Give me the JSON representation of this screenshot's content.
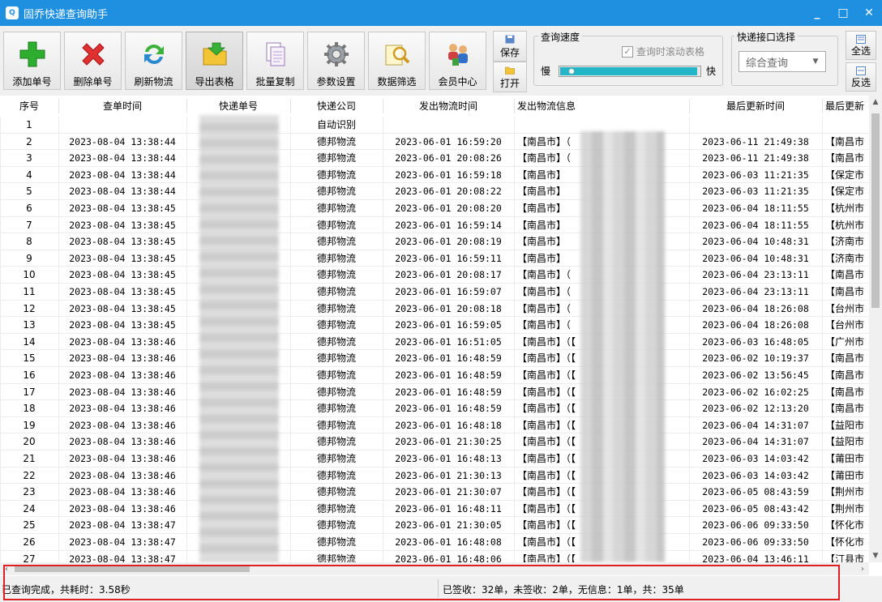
{
  "window": {
    "title": "固乔快递查询助手",
    "minimize": "_",
    "maximize": "□",
    "close": "✕"
  },
  "toolbar": {
    "buttons": [
      {
        "label": "添加单号",
        "icon": "plus-icon"
      },
      {
        "label": "删除单号",
        "icon": "delete-x-icon"
      },
      {
        "label": "刷新物流",
        "icon": "refresh-icon"
      },
      {
        "label": "导出表格",
        "icon": "folder-export-icon"
      },
      {
        "label": "批量复制",
        "icon": "copy-icon"
      },
      {
        "label": "参数设置",
        "icon": "gear-icon"
      },
      {
        "label": "数据筛选",
        "icon": "filter-search-icon"
      },
      {
        "label": "会员中心",
        "icon": "members-icon"
      }
    ],
    "save_label": "保存",
    "open_label": "打开",
    "speed_group": {
      "title": "查询速度",
      "scroll_checkbox_label": "查询时滚动表格",
      "scroll_checked": true,
      "slow_label": "慢",
      "fast_label": "快",
      "speed_level": 0.98
    },
    "api_group": {
      "title": "快递接口选择",
      "selected": "综合查询"
    },
    "select_all_label": "全选",
    "invert_label": "反选"
  },
  "table": {
    "columns": [
      "序号",
      "查单时间",
      "快递单号",
      "快递公司",
      "发出物流时间",
      "发出物流信息",
      "最后更新时间",
      "最后更新"
    ],
    "rows": [
      {
        "no": "1",
        "query_time": "",
        "company": "自动识别",
        "ship_time": "",
        "ship_info": "",
        "update_time": "",
        "update_info": ""
      },
      {
        "no": "2",
        "query_time": "2023-08-04 13:38:44",
        "company": "德邦物流",
        "ship_time": "2023-06-01 16:59:20",
        "ship_info": "【南昌市】（",
        "update_time": "2023-06-11 21:49:38",
        "update_info": "【南昌市"
      },
      {
        "no": "3",
        "query_time": "2023-08-04 13:38:44",
        "company": "德邦物流",
        "ship_time": "2023-06-01 20:08:26",
        "ship_info": "【南昌市】（",
        "update_time": "2023-06-11 21:49:38",
        "update_info": "【南昌市"
      },
      {
        "no": "4",
        "query_time": "2023-08-04 13:38:44",
        "company": "德邦物流",
        "ship_time": "2023-06-01 16:59:18",
        "ship_info": "【南昌市】",
        "update_time": "2023-06-03 11:21:35",
        "update_info": "【保定市"
      },
      {
        "no": "5",
        "query_time": "2023-08-04 13:38:44",
        "company": "德邦物流",
        "ship_time": "2023-06-01 20:08:22",
        "ship_info": "【南昌市】",
        "update_time": "2023-06-03 11:21:35",
        "update_info": "【保定市"
      },
      {
        "no": "6",
        "query_time": "2023-08-04 13:38:45",
        "company": "德邦物流",
        "ship_time": "2023-06-01 20:08:20",
        "ship_info": "【南昌市】",
        "update_time": "2023-06-04 18:11:55",
        "update_info": "【杭州市"
      },
      {
        "no": "7",
        "query_time": "2023-08-04 13:38:45",
        "company": "德邦物流",
        "ship_time": "2023-06-01 16:59:14",
        "ship_info": "【南昌市】",
        "update_time": "2023-06-04 18:11:55",
        "update_info": "【杭州市"
      },
      {
        "no": "8",
        "query_time": "2023-08-04 13:38:45",
        "company": "德邦物流",
        "ship_time": "2023-06-01 20:08:19",
        "ship_info": "【南昌市】",
        "update_time": "2023-06-04 10:48:31",
        "update_info": "【济南市"
      },
      {
        "no": "9",
        "query_time": "2023-08-04 13:38:45",
        "company": "德邦物流",
        "ship_time": "2023-06-01 16:59:11",
        "ship_info": "【南昌市】",
        "update_time": "2023-06-04 10:48:31",
        "update_info": "【济南市"
      },
      {
        "no": "10",
        "query_time": "2023-08-04 13:38:45",
        "company": "德邦物流",
        "ship_time": "2023-06-01 20:08:17",
        "ship_info": "【南昌市】（",
        "update_time": "2023-06-04 23:13:11",
        "update_info": "【南昌市"
      },
      {
        "no": "11",
        "query_time": "2023-08-04 13:38:45",
        "company": "德邦物流",
        "ship_time": "2023-06-01 16:59:07",
        "ship_info": "【南昌市】（",
        "update_time": "2023-06-04 23:13:11",
        "update_info": "【南昌市"
      },
      {
        "no": "12",
        "query_time": "2023-08-04 13:38:45",
        "company": "德邦物流",
        "ship_time": "2023-06-01 20:08:18",
        "ship_info": "【南昌市】（",
        "update_time": "2023-06-04 18:26:08",
        "update_info": "【台州市"
      },
      {
        "no": "13",
        "query_time": "2023-08-04 13:38:45",
        "company": "德邦物流",
        "ship_time": "2023-06-01 16:59:05",
        "ship_info": "【南昌市】（",
        "update_time": "2023-06-04 18:26:08",
        "update_info": "【台州市"
      },
      {
        "no": "14",
        "query_time": "2023-08-04 13:38:46",
        "company": "德邦物流",
        "ship_time": "2023-06-01 16:51:05",
        "ship_info": "【南昌市】（【",
        "update_time": "2023-06-03 16:48:05",
        "update_info": "【广州市"
      },
      {
        "no": "15",
        "query_time": "2023-08-04 13:38:46",
        "company": "德邦物流",
        "ship_time": "2023-06-01 16:48:59",
        "ship_info": "【南昌市】（【",
        "update_time": "2023-06-02 10:19:37",
        "update_info": "【南昌市"
      },
      {
        "no": "16",
        "query_time": "2023-08-04 13:38:46",
        "company": "德邦物流",
        "ship_time": "2023-06-01 16:48:59",
        "ship_info": "【南昌市】（【",
        "update_time": "2023-06-02 13:56:45",
        "update_info": "【南昌市"
      },
      {
        "no": "17",
        "query_time": "2023-08-04 13:38:46",
        "company": "德邦物流",
        "ship_time": "2023-06-01 16:48:59",
        "ship_info": "【南昌市】（【",
        "update_time": "2023-06-02 16:02:25",
        "update_info": "【南昌市"
      },
      {
        "no": "18",
        "query_time": "2023-08-04 13:38:46",
        "company": "德邦物流",
        "ship_time": "2023-06-01 16:48:59",
        "ship_info": "【南昌市】（【",
        "update_time": "2023-06-02 12:13:20",
        "update_info": "【南昌市"
      },
      {
        "no": "19",
        "query_time": "2023-08-04 13:38:46",
        "company": "德邦物流",
        "ship_time": "2023-06-01 16:48:18",
        "ship_info": "【南昌市】（【",
        "update_time": "2023-06-04 14:31:07",
        "update_info": "【益阳市"
      },
      {
        "no": "20",
        "query_time": "2023-08-04 13:38:46",
        "company": "德邦物流",
        "ship_time": "2023-06-01 21:30:25",
        "ship_info": "【南昌市】（【",
        "update_time": "2023-06-04 14:31:07",
        "update_info": "【益阳市"
      },
      {
        "no": "21",
        "query_time": "2023-08-04 13:38:46",
        "company": "德邦物流",
        "ship_time": "2023-06-01 16:48:13",
        "ship_info": "【南昌市】（【",
        "update_time": "2023-06-03 14:03:42",
        "update_info": "【莆田市"
      },
      {
        "no": "22",
        "query_time": "2023-08-04 13:38:46",
        "company": "德邦物流",
        "ship_time": "2023-06-01 21:30:13",
        "ship_info": "【南昌市】（【",
        "update_time": "2023-06-03 14:03:42",
        "update_info": "【莆田市"
      },
      {
        "no": "23",
        "query_time": "2023-08-04 13:38:46",
        "company": "德邦物流",
        "ship_time": "2023-06-01 21:30:07",
        "ship_info": "【南昌市】（【",
        "update_time": "2023-06-05 08:43:59",
        "update_info": "【荆州市"
      },
      {
        "no": "24",
        "query_time": "2023-08-04 13:38:46",
        "company": "德邦物流",
        "ship_time": "2023-06-01 16:48:11",
        "ship_info": "【南昌市】（【",
        "update_time": "2023-06-05 08:43:42",
        "update_info": "【荆州市"
      },
      {
        "no": "25",
        "query_time": "2023-08-04 13:38:47",
        "company": "德邦物流",
        "ship_time": "2023-06-01 21:30:05",
        "ship_info": "【南昌市】（【",
        "update_time": "2023-06-06 09:33:50",
        "update_info": "【怀化市"
      },
      {
        "no": "26",
        "query_time": "2023-08-04 13:38:47",
        "company": "德邦物流",
        "ship_time": "2023-06-01 16:48:08",
        "ship_info": "【南昌市】（【",
        "update_time": "2023-06-06 09:33:50",
        "update_info": "【怀化市"
      },
      {
        "no": "27",
        "query_time": "2023-08-04 13:38:47",
        "company": "德邦物流",
        "ship_time": "2023-06-01 16:48:06",
        "ship_info": "【南昌市】（【",
        "update_time": "2023-06-04 13:46:11",
        "update_info": "【汀县市"
      }
    ]
  },
  "status": {
    "left": "已查询完成，共耗时：3.58秒",
    "right": "已签收：32单，未签收：2单，无信息：1单，共：35单"
  }
}
